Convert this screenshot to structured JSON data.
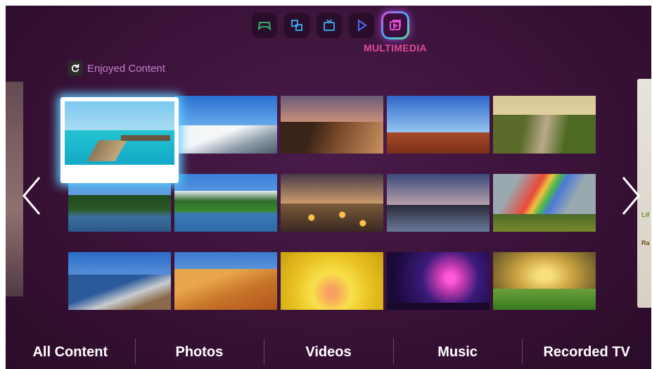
{
  "hub": {
    "icons": [
      {
        "name": "games-icon",
        "color": "#2fb36a"
      },
      {
        "name": "apps-icon",
        "color": "#3aa1e0"
      },
      {
        "name": "tv-icon",
        "color": "#3aa1e0"
      },
      {
        "name": "play-icon",
        "color": "#4d6cf0"
      },
      {
        "name": "multimedia-icon",
        "color": "#e24cd1",
        "active": true
      }
    ],
    "active_label": "MULTIMEDIA"
  },
  "section": {
    "title": "Enjoyed Content",
    "icon": "refresh-icon"
  },
  "side_right": {
    "tag1": "Lif",
    "tag2": "Ra"
  },
  "navigation": {
    "left_arrow": "chevron-left-icon",
    "right_arrow": "chevron-right-icon"
  },
  "tabs": [
    {
      "label": "All Content"
    },
    {
      "label": "Photos"
    },
    {
      "label": "Videos"
    },
    {
      "label": "Music"
    },
    {
      "label": "Recorded TV"
    }
  ],
  "thumbnails": [
    {
      "name": "tropical-pier",
      "focused": true
    },
    {
      "name": "snowy-mountain"
    },
    {
      "name": "coastal-sunset"
    },
    {
      "name": "desert-rocks-coast"
    },
    {
      "name": "country-road-motorcycle"
    },
    {
      "name": "forest-lake"
    },
    {
      "name": "mountain-reflection"
    },
    {
      "name": "floating-lanterns"
    },
    {
      "name": "marina-sunset"
    },
    {
      "name": "rainbow-field"
    },
    {
      "name": "sailboat-deck"
    },
    {
      "name": "sand-dunes"
    },
    {
      "name": "yellow-flower"
    },
    {
      "name": "fireworks"
    },
    {
      "name": "golden-meadow"
    }
  ]
}
